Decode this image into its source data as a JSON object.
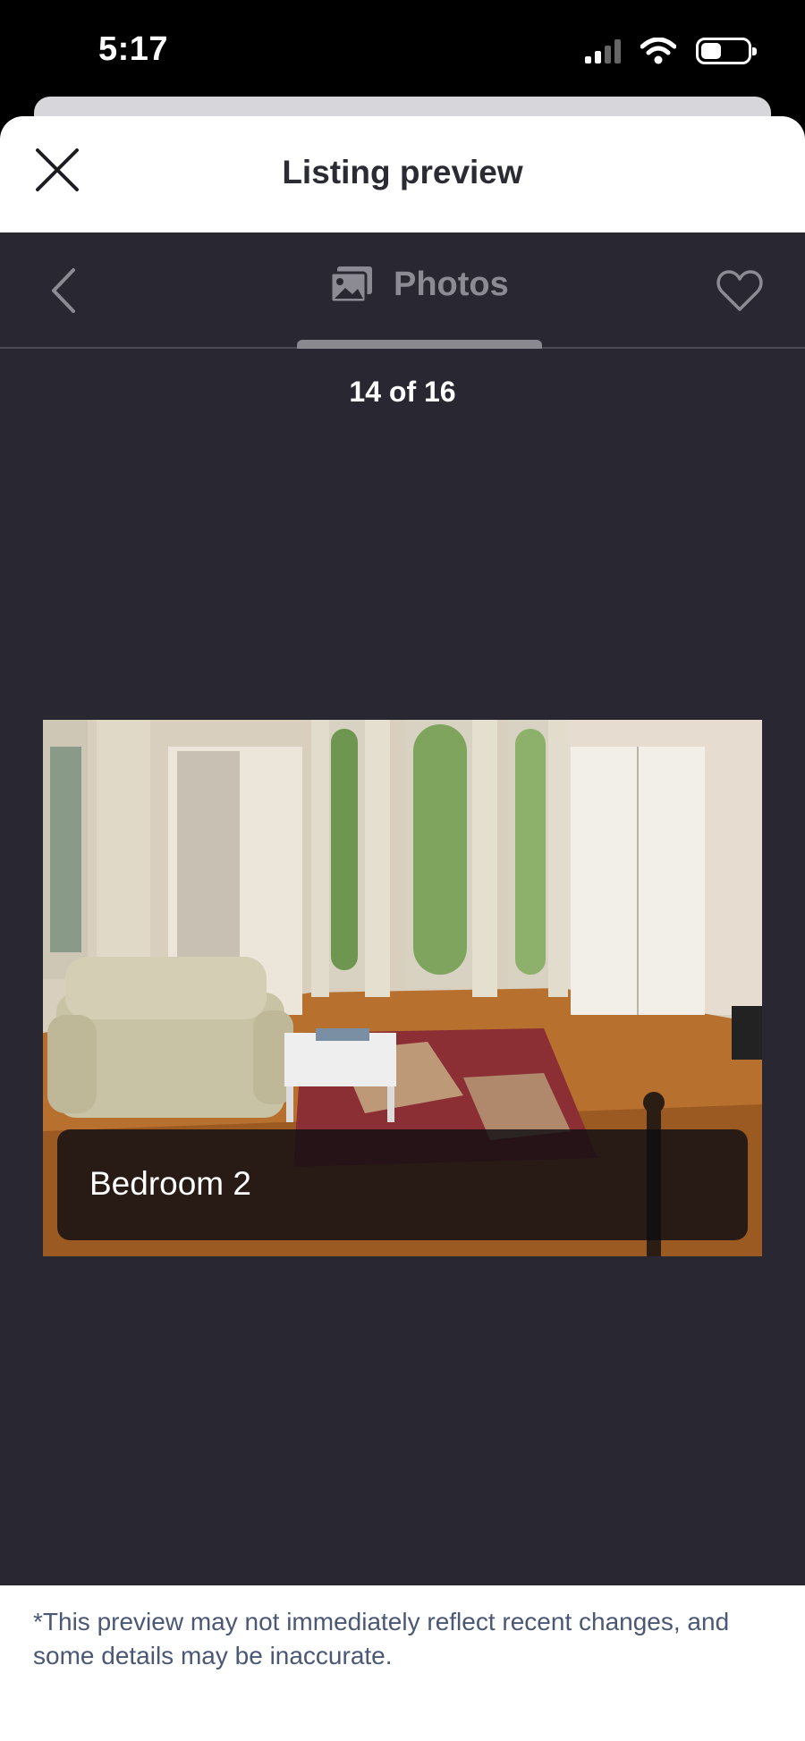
{
  "status_bar": {
    "time": "5:17",
    "signal_icon": "cellular-signal-icon",
    "wifi_icon": "wifi-icon",
    "battery_icon": "battery-icon"
  },
  "header": {
    "title": "Listing preview",
    "close_icon": "close-icon"
  },
  "viewer": {
    "back_icon": "chevron-left-icon",
    "tab_icon": "photos-icon",
    "tab_label": "Photos",
    "favorite_icon": "heart-outline-icon",
    "counter": "14 of 16",
    "photo": {
      "caption": "Bedroom 2"
    }
  },
  "footer": {
    "disclaimer": "*This preview may not immediately reflect recent changes, and some details may be inaccurate."
  },
  "colors": {
    "viewer_background": "#292832",
    "header_background": "#ffffff",
    "disclaimer_text": "#4a5876"
  }
}
